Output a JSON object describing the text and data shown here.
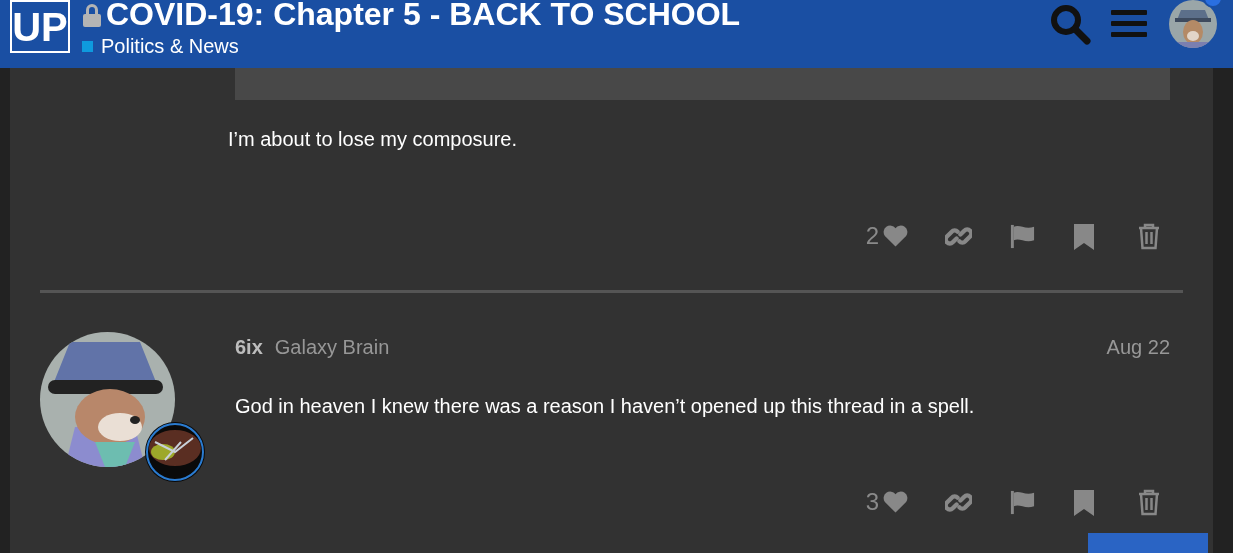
{
  "header": {
    "logo": "UP",
    "locked": true,
    "title": "COVID-19: Chapter 5 - BACK TO SCHOOL",
    "category": {
      "name": "Politics & News",
      "color": "#0e9ade"
    },
    "notification": true
  },
  "posts": [
    {
      "kind": "continued",
      "body": "I’m about to lose my composure.",
      "likes": "2"
    },
    {
      "kind": "full",
      "username": "6ix",
      "user_title": "Galaxy Brain",
      "date": "Aug 22",
      "body": "God in heaven I knew there was a reason I haven’t opened up this thread in a spell.",
      "likes": "3"
    }
  ]
}
